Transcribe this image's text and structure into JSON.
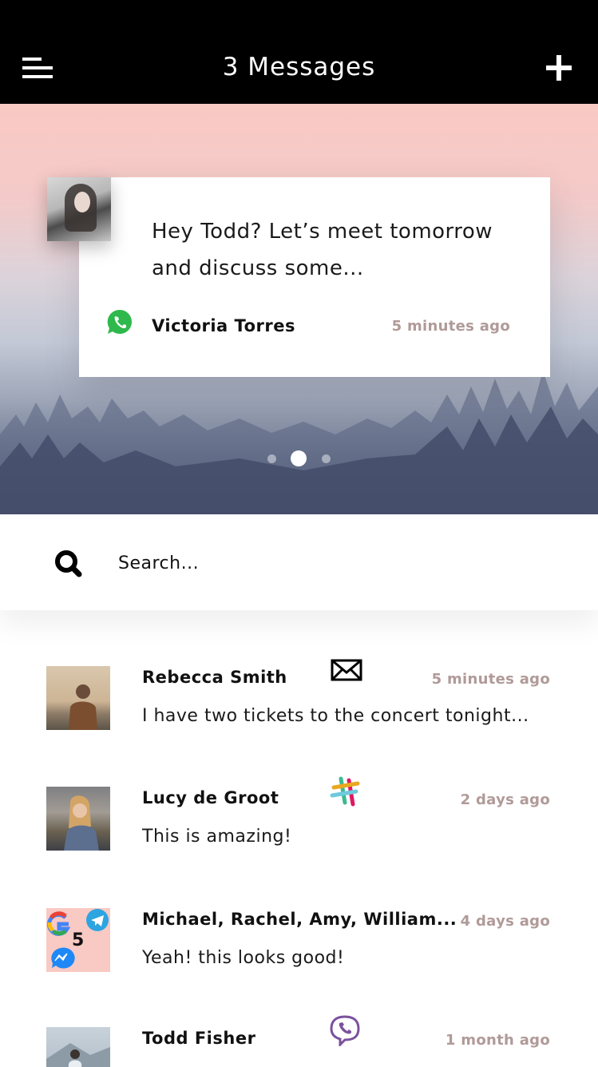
{
  "header": {
    "title": "3 Messages",
    "menu_icon": "hamburger-menu-icon",
    "add_icon": "plus-icon"
  },
  "hero": {
    "message": "Hey Todd? Let’s meet tomorrow and discuss some...",
    "sender": "Victoria Torres",
    "time": "5 minutes ago",
    "app_icon": "whatsapp-icon",
    "carousel": {
      "total": 3,
      "active_index": 1
    }
  },
  "search": {
    "placeholder": "Search...",
    "icon": "search-icon"
  },
  "messages": [
    {
      "name": "Rebecca Smith",
      "time": "5 minutes ago",
      "text": "I have two tickets to the concert tonight...",
      "app_icon": "mail-icon"
    },
    {
      "name": "Lucy de Groot",
      "time": "2 days ago",
      "text": "This is amazing!",
      "app_icon": "slack-icon"
    },
    {
      "name": "Michael, Rachel, Amy, William...",
      "time": "4 days ago",
      "text": "Yeah! this looks good!",
      "group_count": "5",
      "group_icons": [
        "google-icon",
        "telegram-icon",
        "messenger-icon"
      ]
    },
    {
      "name": "Todd Fisher",
      "time": "1 month ago",
      "text": "",
      "app_icon": "viber-icon"
    }
  ],
  "colors": {
    "header_bg": "#000000",
    "accent_time": "#b09a98",
    "hero_pink": "#f9c9c4"
  }
}
